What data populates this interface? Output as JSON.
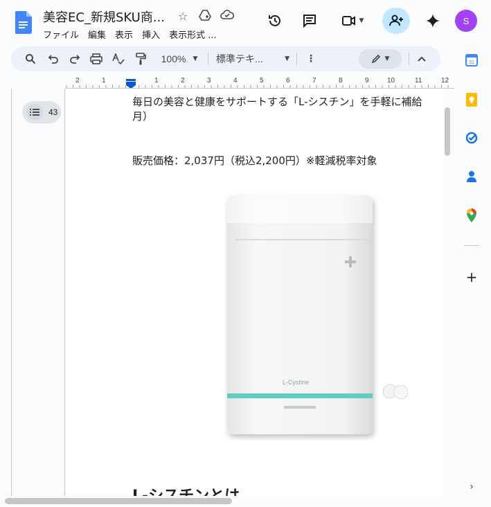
{
  "header": {
    "title": "美容EC_新規SKU商...",
    "menu": [
      "ファイル",
      "編集",
      "表示",
      "挿入",
      "表示形式 ..."
    ],
    "avatar_initial": "S"
  },
  "toolbar": {
    "zoom": "100%",
    "style": "標準テキ...",
    "more": "⋮"
  },
  "ruler": {
    "numbers": [
      "2",
      "1",
      "1",
      "2",
      "3",
      "4",
      "5",
      "6",
      "7",
      "8",
      "9",
      "10",
      "11",
      "12"
    ]
  },
  "outline": {
    "count": "43"
  },
  "document": {
    "line1": "毎日の美容と健康をサポートする「L-シスチン」を手軽に補給",
    "line2": "月）",
    "price": "販売価格：2,037円（税込2,200円）※軽減税率対象",
    "product_label": "L-Cystine",
    "heading": "L-シスチンとは"
  },
  "colors": {
    "accent": "#0b57d0",
    "share_bg": "#c2e7ff",
    "avatar_bg": "#a142f4",
    "band": "#5ecfbf"
  }
}
